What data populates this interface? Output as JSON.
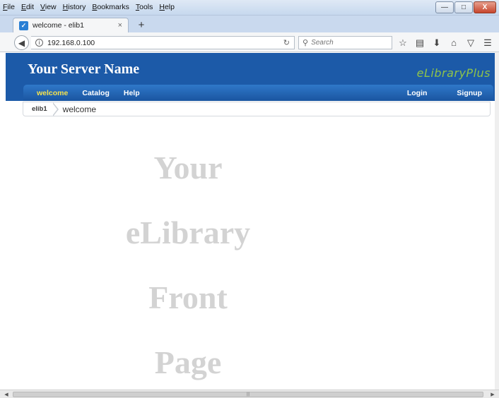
{
  "browser": {
    "menu": [
      "File",
      "Edit",
      "View",
      "History",
      "Bookmarks",
      "Tools",
      "Help"
    ],
    "tab": {
      "title": "welcome - elib1",
      "close": "×"
    },
    "new_tab": "+",
    "url": "192.168.0.100",
    "search_placeholder": "Search",
    "window_buttons": {
      "minimize": "—",
      "maximize": "□",
      "close": "X"
    }
  },
  "site": {
    "server_name": "Your Server Name",
    "brand": "eLibraryPlus",
    "nav": {
      "left": [
        "welcome",
        "Catalog",
        "Help"
      ],
      "right": [
        "Login",
        "Signup"
      ],
      "active": "welcome"
    },
    "breadcrumb": {
      "root": "elib1",
      "current": "welcome"
    },
    "front_page_lines": [
      "Your",
      "eLibrary",
      "Front",
      "Page"
    ]
  },
  "colors": {
    "header_bg": "#1c5aa8",
    "active_nav": "#f5e24d",
    "brand": "#8fc34a",
    "placeholder_text": "#d3d3d3"
  }
}
